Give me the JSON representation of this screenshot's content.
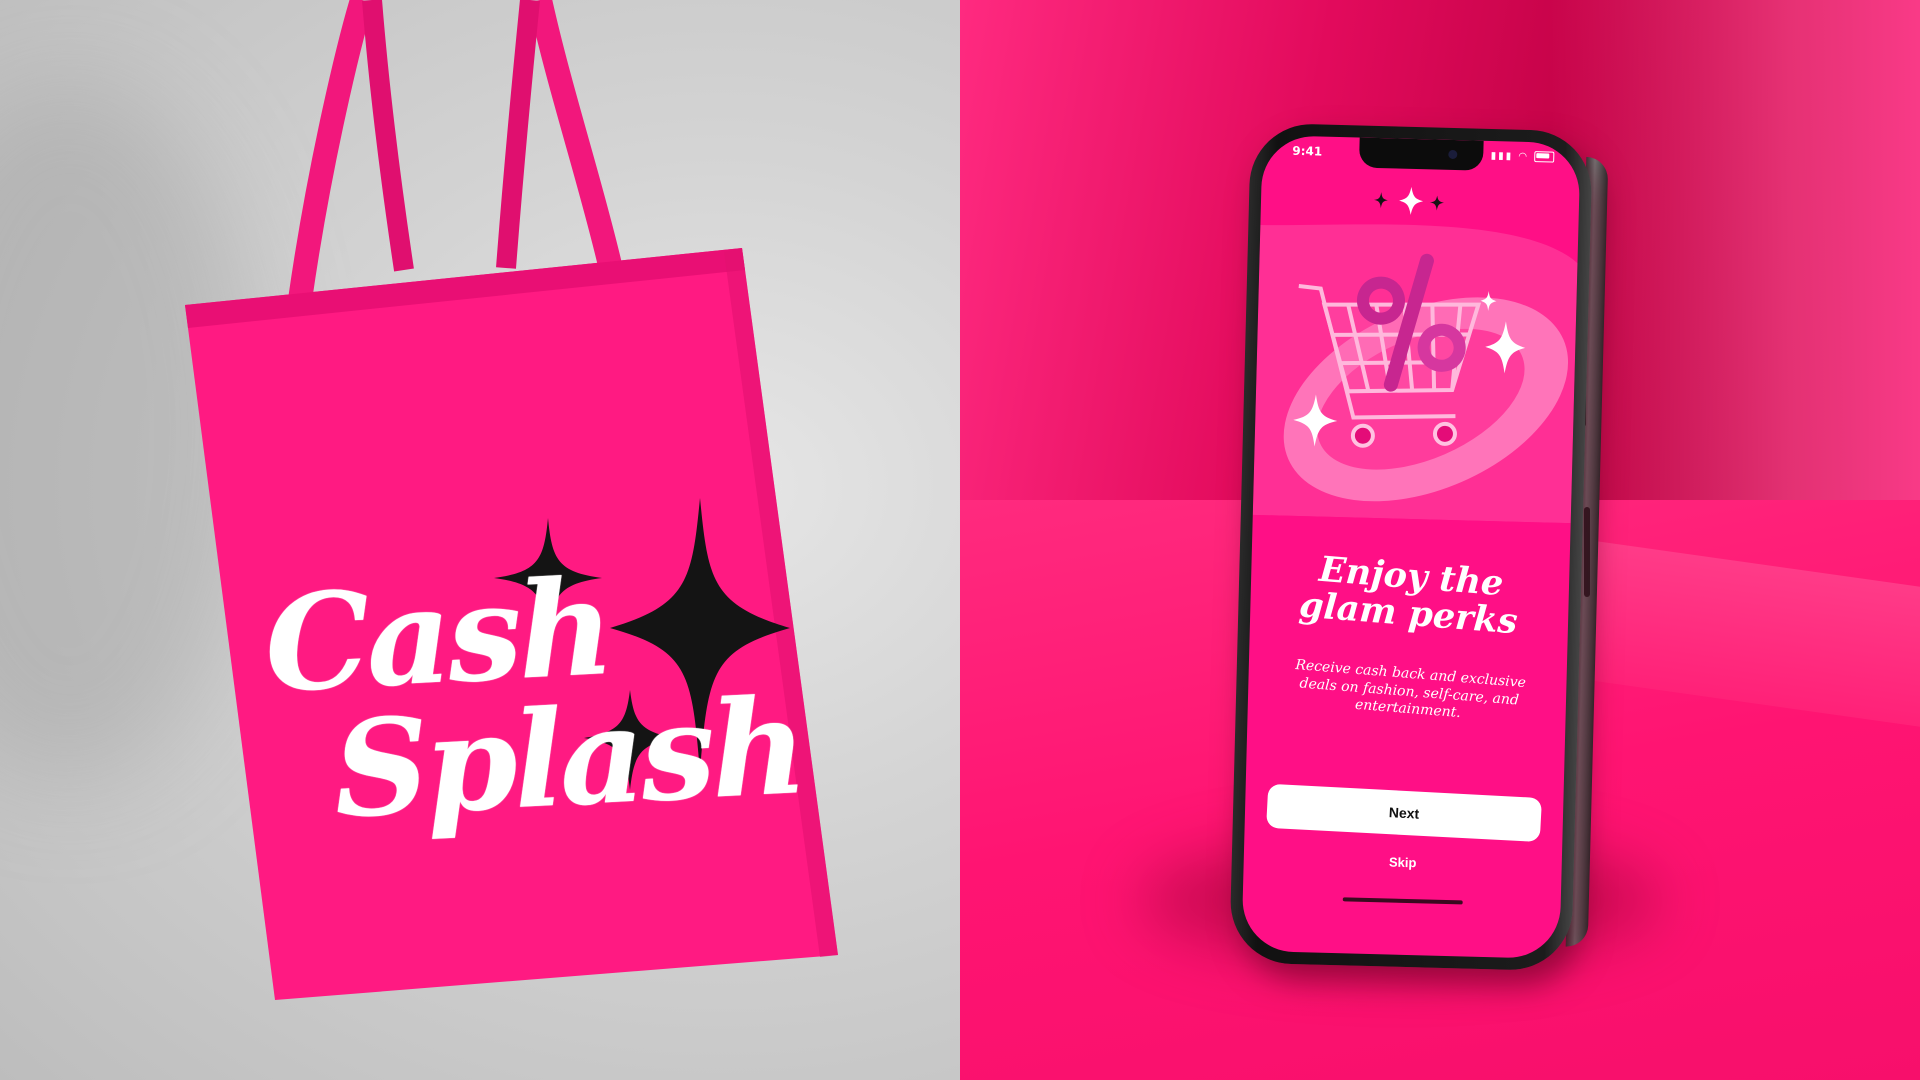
{
  "tote": {
    "line1": "Cash",
    "line2": "Splash"
  },
  "phone": {
    "status_time": "9:41",
    "headline_line1": "Enjoy the",
    "headline_line2": "glam perks",
    "subtitle": "Receive cash back and exclusive deals on fashion, self-care, and entertainment.",
    "next_label": "Next",
    "skip_label": "Skip",
    "hero_icon": "shopping-cart-percent-icon"
  },
  "colors": {
    "brand_pink": "#ff0f86",
    "background_magenta": "#ff1472",
    "tote_pink": "#ff1a82",
    "sparkle_black": "#141414",
    "text_white": "#ffffff"
  }
}
